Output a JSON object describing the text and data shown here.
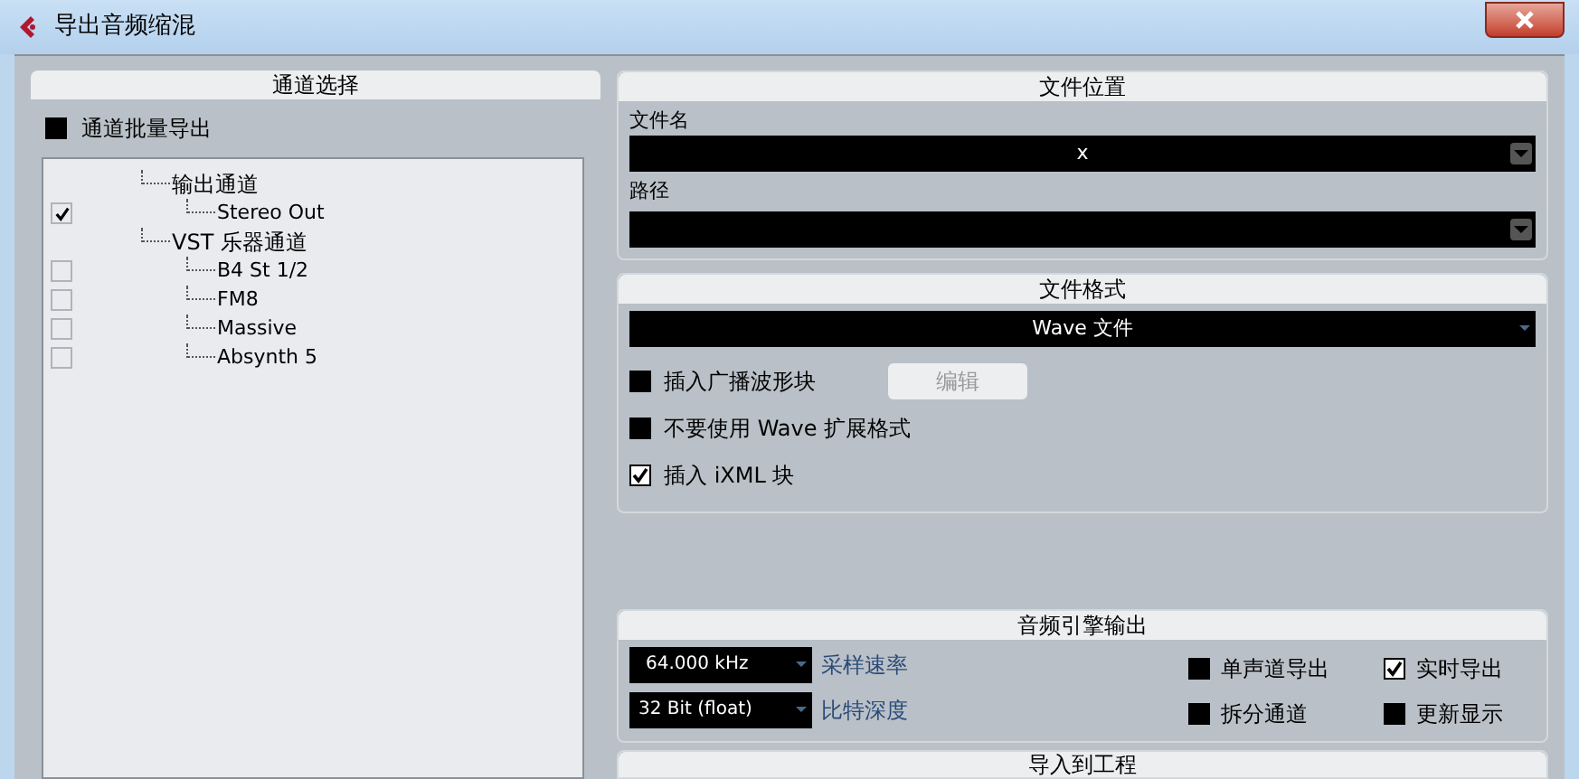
{
  "window": {
    "title": "导出音频缩混"
  },
  "channel_select": {
    "title": "通道选择",
    "batch_export": {
      "label": "通道批量导出",
      "checked": false
    },
    "tree": [
      {
        "label": "输出通道",
        "children": [
          {
            "label": "Stereo Out",
            "checked": true
          }
        ]
      },
      {
        "label": "VST 乐器通道",
        "children": [
          {
            "label": "B4 St 1/2",
            "checked": false
          },
          {
            "label": "FM8",
            "checked": false
          },
          {
            "label": "Massive",
            "checked": false
          },
          {
            "label": "Absynth 5",
            "checked": false
          }
        ]
      }
    ]
  },
  "file_location": {
    "title": "文件位置",
    "name_label": "文件名",
    "name_value": "x",
    "path_label": "路径"
  },
  "file_format": {
    "title": "文件格式",
    "format": "Wave 文件",
    "edit_button": "编辑",
    "options": [
      {
        "label": "插入广播波形块",
        "checked": false
      },
      {
        "label": "不要使用 Wave 扩展格式",
        "checked": false
      },
      {
        "label": "插入 iXML 块",
        "checked": true
      }
    ]
  },
  "engine_output": {
    "title": "音频引擎输出",
    "sample_rate": {
      "value": "64.000 kHz",
      "label": "采样速率"
    },
    "bit_depth": {
      "value": "32 Bit (float)",
      "label": "比特深度"
    },
    "options": [
      {
        "label": "单声道导出",
        "checked": false
      },
      {
        "label": "实时导出",
        "checked": true
      },
      {
        "label": "拆分通道",
        "checked": false
      },
      {
        "label": "更新显示",
        "checked": false
      }
    ]
  },
  "import_to_project": {
    "title": "导入到工程"
  }
}
